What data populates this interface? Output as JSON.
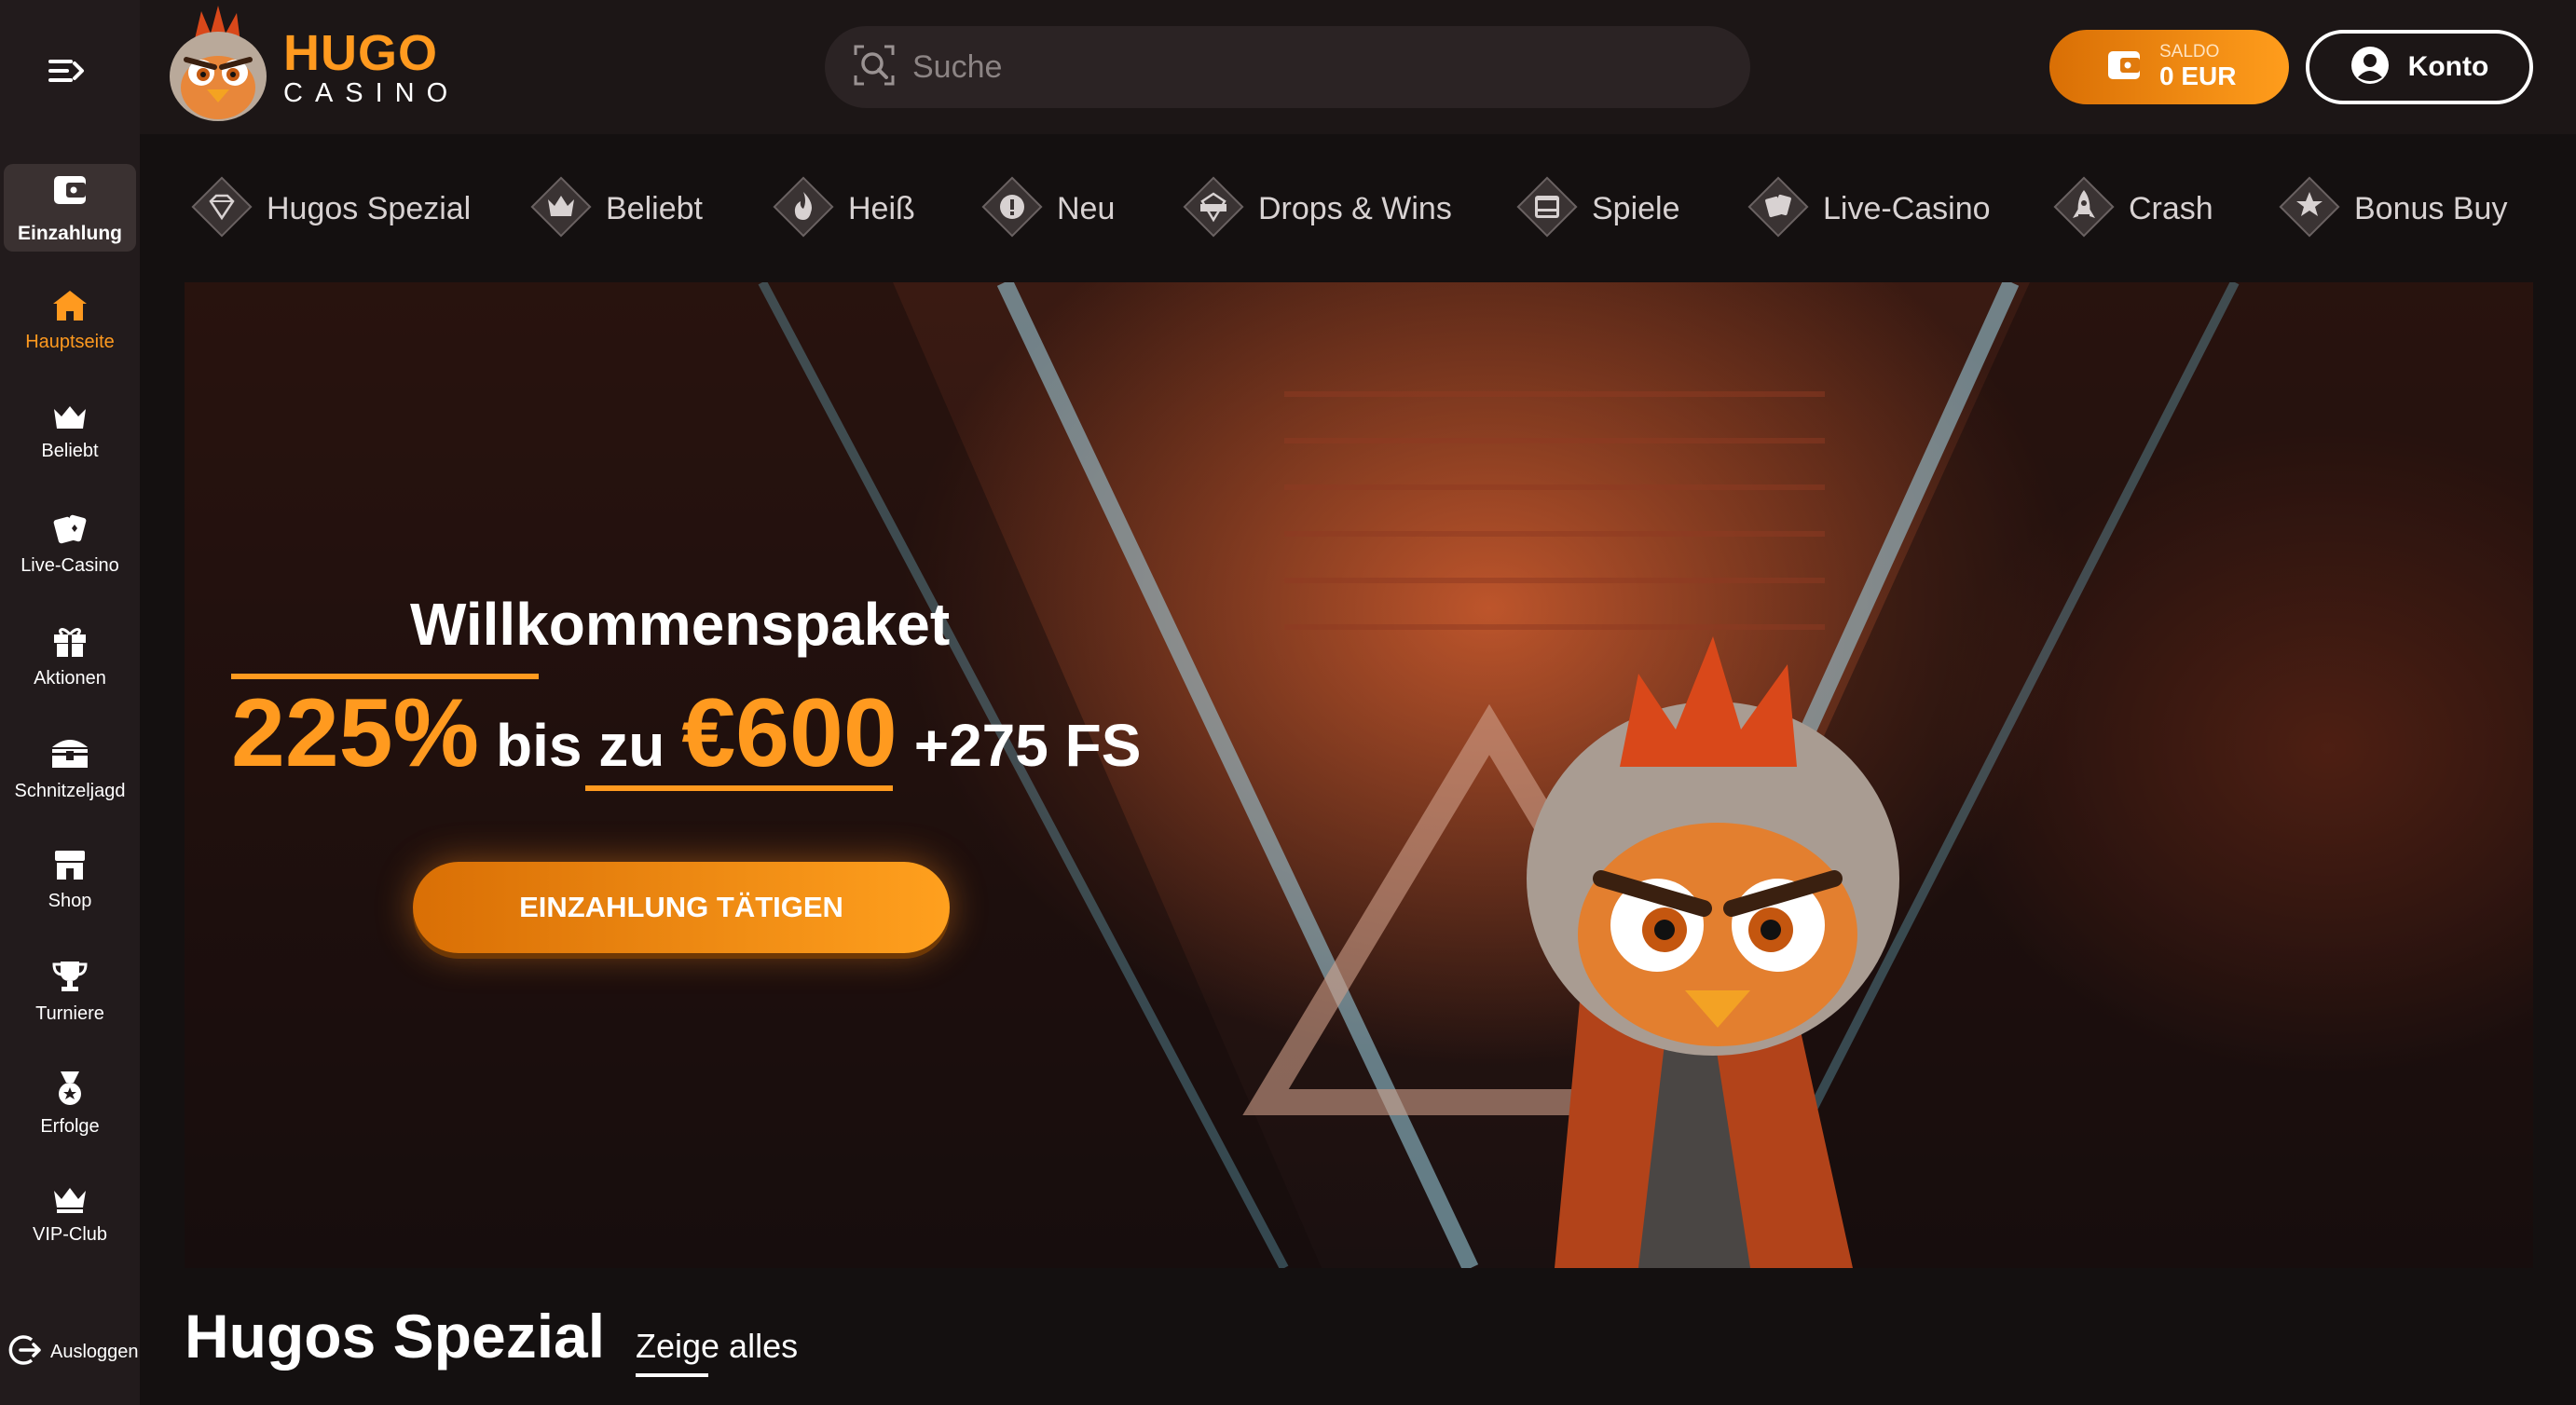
{
  "brand": {
    "name": "HUGO",
    "subtitle": "CASINO"
  },
  "header": {
    "search_placeholder": "Suche",
    "balance_label": "SALDO",
    "balance_value": "0 EUR",
    "account_label": "Konto"
  },
  "sidebar": {
    "deposit_label": "Einzahlung",
    "items": [
      {
        "label": "Hauptseite",
        "icon": "home-icon",
        "active": true
      },
      {
        "label": "Beliebt",
        "icon": "crown-icon"
      },
      {
        "label": "Live-Casino",
        "icon": "cards-icon"
      },
      {
        "label": "Aktionen",
        "icon": "gift-icon"
      },
      {
        "label": "Schnitzeljagd",
        "icon": "treasure-chest-icon"
      },
      {
        "label": "Shop",
        "icon": "shop-icon"
      },
      {
        "label": "Turniere",
        "icon": "trophy-icon"
      },
      {
        "label": "Erfolge",
        "icon": "medal-icon"
      },
      {
        "label": "VIP-Club",
        "icon": "vip-crown-icon"
      }
    ],
    "logout_label": "Ausloggen"
  },
  "categories": [
    {
      "label": "Hugos Spezial",
      "icon": "diamond-icon"
    },
    {
      "label": "Beliebt",
      "icon": "crown-icon"
    },
    {
      "label": "Heiß",
      "icon": "flame-icon"
    },
    {
      "label": "Neu",
      "icon": "exclamation-icon"
    },
    {
      "label": "Drops & Wins",
      "icon": "drops-wins-icon"
    },
    {
      "label": "Spiele",
      "icon": "slot-machine-icon"
    },
    {
      "label": "Live-Casino",
      "icon": "cards-icon"
    },
    {
      "label": "Crash",
      "icon": "rocket-icon"
    },
    {
      "label": "Bonus Buy",
      "icon": "star-cart-icon"
    }
  ],
  "banner": {
    "headline": "Willkommenspaket",
    "percent": "225%",
    "up_to": "bis zu",
    "amount": "€600",
    "free_spins": "+275 FS",
    "cta_label": "EINZAHLUNG TÄTIGEN"
  },
  "section": {
    "title": "Hugos Spezial",
    "show_all": "Zeige alles"
  },
  "colors": {
    "accent": "#ff9a1f",
    "background": "#141010",
    "sidebar": "#221b1c",
    "header": "#1c1616"
  }
}
